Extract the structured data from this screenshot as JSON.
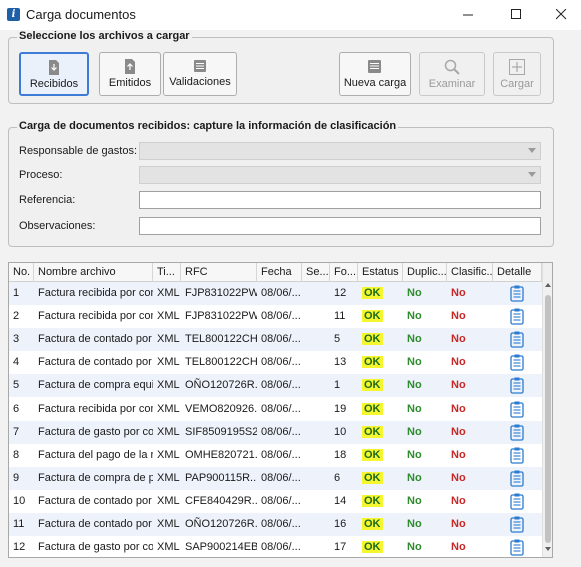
{
  "window": {
    "title": "Carga documentos",
    "min_glyph": "—",
    "max_glyph": "☐",
    "close_glyph": "✕"
  },
  "archivos_group": {
    "title": "Seleccione los archivos a cargar",
    "buttons": {
      "recibidos": "Recibidos",
      "emitidos": "Emitidos",
      "validaciones": "Validaciones",
      "nueva_carga": "Nueva carga",
      "examinar": "Examinar",
      "cargar": "Cargar"
    }
  },
  "clasificacion_group": {
    "title": "Carga de documentos recibidos: capture la información de clasificación",
    "labels": {
      "responsable": "Responsable de gastos:",
      "proceso": "Proceso:",
      "referencia": "Referencia:",
      "observaciones": "Observaciones:"
    },
    "values": {
      "responsable": "",
      "proceso": "",
      "referencia": "",
      "observaciones": ""
    }
  },
  "table": {
    "headers": [
      "No.",
      "Nombre archivo",
      "Ti...",
      "RFC",
      "Fecha",
      "Se...",
      "Fo...",
      "Estatus",
      "Duplic...",
      "Clasific...",
      "Detalle"
    ],
    "rows": [
      {
        "no": "1",
        "nombre": "Factura recibida por con...",
        "tipo": "XML",
        "rfc": "FJP831022PW1",
        "fecha": "08/06/...",
        "serie": "",
        "folio": "12",
        "estatus": "OK",
        "duplicado": "No",
        "clasificado": "No"
      },
      {
        "no": "2",
        "nombre": "Factura recibida por con...",
        "tipo": "XML",
        "rfc": "FJP831022PW1",
        "fecha": "08/06/...",
        "serie": "",
        "folio": "11",
        "estatus": "OK",
        "duplicado": "No",
        "clasificado": "No"
      },
      {
        "no": "3",
        "nombre": "Factura de contado por c...",
        "tipo": "XML",
        "rfc": "TEL800122CH2",
        "fecha": "08/06/...",
        "serie": "",
        "folio": "5",
        "estatus": "OK",
        "duplicado": "No",
        "clasificado": "No"
      },
      {
        "no": "4",
        "nombre": "Factura de contado por c...",
        "tipo": "XML",
        "rfc": "TEL800122CH2",
        "fecha": "08/06/...",
        "serie": "",
        "folio": "13",
        "estatus": "OK",
        "duplicado": "No",
        "clasificado": "No"
      },
      {
        "no": "5",
        "nombre": "Factura de compra equip...",
        "tipo": "XML",
        "rfc": "OÑO120726R...",
        "fecha": "08/06/...",
        "serie": "",
        "folio": "1",
        "estatus": "OK",
        "duplicado": "No",
        "clasificado": "No"
      },
      {
        "no": "6",
        "nombre": "Factura recibida por con...",
        "tipo": "XML",
        "rfc": "VEMO820926...",
        "fecha": "08/06/...",
        "serie": "",
        "folio": "19",
        "estatus": "OK",
        "duplicado": "No",
        "clasificado": "No"
      },
      {
        "no": "7",
        "nombre": "Factura de gasto por con...",
        "tipo": "XML",
        "rfc": "SIF8509195S2",
        "fecha": "08/06/...",
        "serie": "",
        "folio": "10",
        "estatus": "OK",
        "duplicado": "No",
        "clasificado": "No"
      },
      {
        "no": "8",
        "nombre": "Factura del pago de la re...",
        "tipo": "XML",
        "rfc": "OMHE820721...",
        "fecha": "08/06/...",
        "serie": "",
        "folio": "18",
        "estatus": "OK",
        "duplicado": "No",
        "clasificado": "No"
      },
      {
        "no": "9",
        "nombre": "Factura de compra de pa...",
        "tipo": "XML",
        "rfc": "PAP900115R...",
        "fecha": "08/06/...",
        "serie": "",
        "folio": "6",
        "estatus": "OK",
        "duplicado": "No",
        "clasificado": "No"
      },
      {
        "no": "10",
        "nombre": "Factura de contado por c...",
        "tipo": "XML",
        "rfc": "CFE840429R...",
        "fecha": "08/06/...",
        "serie": "",
        "folio": "14",
        "estatus": "OK",
        "duplicado": "No",
        "clasificado": "No"
      },
      {
        "no": "11",
        "nombre": "Factura de contado por c...",
        "tipo": "XML",
        "rfc": "OÑO120726R...",
        "fecha": "08/06/...",
        "serie": "",
        "folio": "16",
        "estatus": "OK",
        "duplicado": "No",
        "clasificado": "No"
      },
      {
        "no": "12",
        "nombre": "Factura de gasto por con...",
        "tipo": "XML",
        "rfc": "SAP900214EB9",
        "fecha": "08/06/...",
        "serie": "",
        "folio": "17",
        "estatus": "OK",
        "duplicado": "No",
        "clasificado": "No"
      }
    ]
  },
  "colors": {
    "highlight": "#f5f530",
    "ok_green": "#1f6e1f",
    "no_green": "#2e8b2e",
    "no_red": "#c62828",
    "detail_icon": "#2b7bd0",
    "active_button_border": "#3d7bd6"
  },
  "icons": {
    "app": "app-logo-icon",
    "recibidos": "document-download-icon",
    "emitidos": "document-upload-icon",
    "validaciones": "stack-list-icon",
    "nueva_carga": "new-document-icon",
    "examinar": "magnifier-icon",
    "cargar": "plus-box-icon",
    "detalle": "clipboard-list-icon"
  }
}
